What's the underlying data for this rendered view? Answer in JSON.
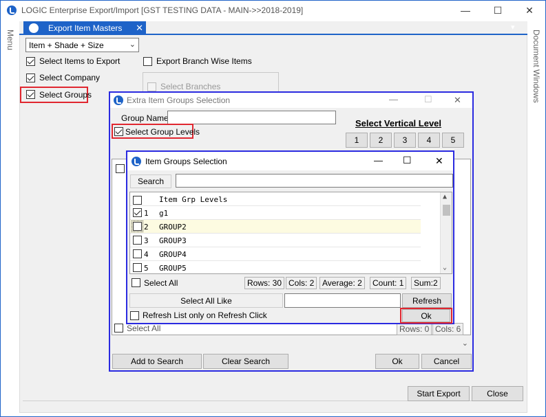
{
  "app": {
    "title": "LOGIC Enterprise Export/Import  [GST TESTING DATA - MAIN->>2018-2019]",
    "minimize": "—",
    "maximize": "☐",
    "close": "✕",
    "left_menu": "Menu",
    "right_panel": "Document Windows"
  },
  "doc_tab": {
    "label": "Export Item Masters",
    "close": "✕",
    "dropdown": "▾"
  },
  "export_form": {
    "item_type": "Item + Shade + Size",
    "checkbox_items": "Select Items to Export",
    "checkbox_company": "Select Company",
    "checkbox_groups": "Select Groups",
    "checkbox_branch_items": "Export Branch Wise Items",
    "checkbox_branches": "Select Branches",
    "start_export": "Start Export",
    "close": "Close"
  },
  "extra_dialog": {
    "title": "Extra Item Groups Selection",
    "group_name_label": "Group Name",
    "group_name_value": "",
    "select_group_levels": "Select Group Levels",
    "vertical_level_label": "Select Vertical Level",
    "levels": [
      "1",
      "2",
      "3",
      "4",
      "5"
    ],
    "select_all": "Select All",
    "status_rows": "Rows: 0",
    "status_cols": "Cols: 6",
    "add_to_search": "Add to Search",
    "clear_search": "Clear Search",
    "ok": "Ok",
    "cancel": "Cancel"
  },
  "groups_dialog": {
    "title": "Item Groups Selection",
    "search_label": "Search",
    "search_value": "",
    "header": "Item Grp Levels",
    "rows": [
      {
        "num": "1",
        "name": "g1",
        "checked": true
      },
      {
        "num": "2",
        "name": "GROUP2",
        "checked": false
      },
      {
        "num": "3",
        "name": "GROUP3",
        "checked": false
      },
      {
        "num": "4",
        "name": "GROUP4",
        "checked": false
      },
      {
        "num": "5",
        "name": "GROUP5",
        "checked": false
      }
    ],
    "select_all": "Select All",
    "status": {
      "rows": "Rows: 30",
      "cols": "Cols: 2",
      "average": "Average: 2",
      "count": "Count: 1",
      "sum": "Sum:2"
    },
    "select_all_like": "Select All Like",
    "select_all_like_value": "",
    "refresh": "Refresh",
    "refresh_only_on_click": "Refresh List only on Refresh Click",
    "ok": "Ok"
  }
}
